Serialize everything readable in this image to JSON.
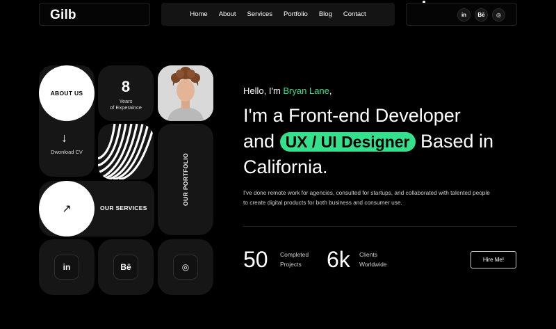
{
  "header": {
    "logo": "Gilb",
    "nav": [
      "Home",
      "About",
      "Services",
      "Portfolio",
      "Blog",
      "Contact"
    ],
    "social": [
      "in",
      "Bē",
      "◎"
    ]
  },
  "tiles": {
    "about_label": "ABOUT US",
    "download_label": "Dwonload CV",
    "years_number": "8",
    "years_label_line1": "Years",
    "years_label_line2": "of Experaince",
    "portfolio_label": "OUR PORTFOLIO",
    "services_label": "OUR SERVICES",
    "social": [
      "in",
      "Bē",
      "◎"
    ]
  },
  "hero": {
    "greeting": "Hello, I'm ",
    "name": "Bryan Lane",
    "greeting_end": ",",
    "line1": "I'm a Front-end Developer",
    "and": "and ",
    "highlight": "UX / UI Designer",
    "based": " Based in",
    "line3": "California.",
    "description": "I've done remote work for agencies, consulted for startups, and collaborated with talented people to create digital products for both business and consumer use."
  },
  "stats": [
    {
      "value": "50",
      "label1": "Completed",
      "label2": "Projects"
    },
    {
      "value": "6k",
      "label1": "Clients",
      "label2": "Worldwide"
    }
  ],
  "cta": {
    "hire": "Hire Me!"
  },
  "colors": {
    "accent": "#35e08c",
    "tile": "#161616",
    "background": "#000000"
  }
}
